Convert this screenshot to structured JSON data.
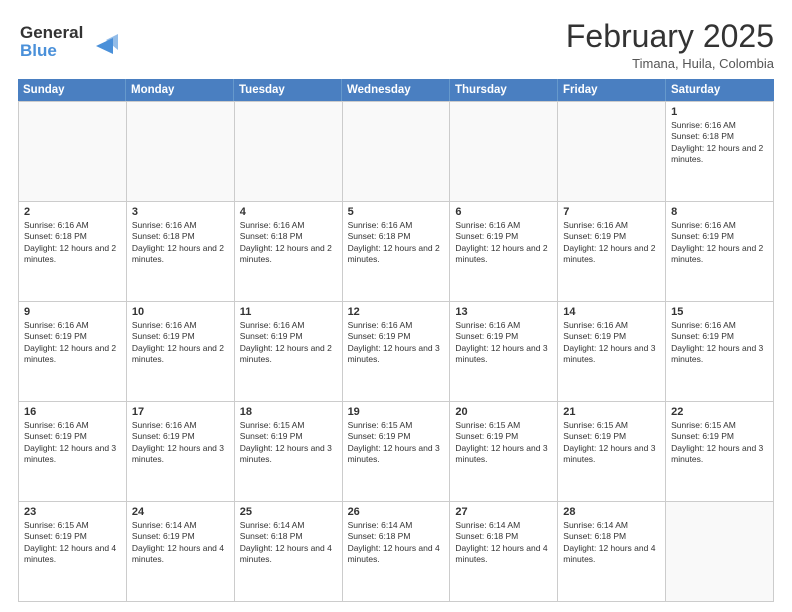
{
  "logo": {
    "line1": "General",
    "line2": "Blue",
    "arrow_color": "#4a90d9"
  },
  "title": {
    "month_year": "February 2025",
    "location": "Timana, Huila, Colombia"
  },
  "header_days": [
    "Sunday",
    "Monday",
    "Tuesday",
    "Wednesday",
    "Thursday",
    "Friday",
    "Saturday"
  ],
  "weeks": [
    {
      "days": [
        {
          "num": "",
          "info": ""
        },
        {
          "num": "",
          "info": ""
        },
        {
          "num": "",
          "info": ""
        },
        {
          "num": "",
          "info": ""
        },
        {
          "num": "",
          "info": ""
        },
        {
          "num": "",
          "info": ""
        },
        {
          "num": "1",
          "info": "Sunrise: 6:16 AM\nSunset: 6:18 PM\nDaylight: 12 hours and 2 minutes."
        }
      ]
    },
    {
      "days": [
        {
          "num": "2",
          "info": "Sunrise: 6:16 AM\nSunset: 6:18 PM\nDaylight: 12 hours and 2 minutes."
        },
        {
          "num": "3",
          "info": "Sunrise: 6:16 AM\nSunset: 6:18 PM\nDaylight: 12 hours and 2 minutes."
        },
        {
          "num": "4",
          "info": "Sunrise: 6:16 AM\nSunset: 6:18 PM\nDaylight: 12 hours and 2 minutes."
        },
        {
          "num": "5",
          "info": "Sunrise: 6:16 AM\nSunset: 6:18 PM\nDaylight: 12 hours and 2 minutes."
        },
        {
          "num": "6",
          "info": "Sunrise: 6:16 AM\nSunset: 6:19 PM\nDaylight: 12 hours and 2 minutes."
        },
        {
          "num": "7",
          "info": "Sunrise: 6:16 AM\nSunset: 6:19 PM\nDaylight: 12 hours and 2 minutes."
        },
        {
          "num": "8",
          "info": "Sunrise: 6:16 AM\nSunset: 6:19 PM\nDaylight: 12 hours and 2 minutes."
        }
      ]
    },
    {
      "days": [
        {
          "num": "9",
          "info": "Sunrise: 6:16 AM\nSunset: 6:19 PM\nDaylight: 12 hours and 2 minutes."
        },
        {
          "num": "10",
          "info": "Sunrise: 6:16 AM\nSunset: 6:19 PM\nDaylight: 12 hours and 2 minutes."
        },
        {
          "num": "11",
          "info": "Sunrise: 6:16 AM\nSunset: 6:19 PM\nDaylight: 12 hours and 2 minutes."
        },
        {
          "num": "12",
          "info": "Sunrise: 6:16 AM\nSunset: 6:19 PM\nDaylight: 12 hours and 3 minutes."
        },
        {
          "num": "13",
          "info": "Sunrise: 6:16 AM\nSunset: 6:19 PM\nDaylight: 12 hours and 3 minutes."
        },
        {
          "num": "14",
          "info": "Sunrise: 6:16 AM\nSunset: 6:19 PM\nDaylight: 12 hours and 3 minutes."
        },
        {
          "num": "15",
          "info": "Sunrise: 6:16 AM\nSunset: 6:19 PM\nDaylight: 12 hours and 3 minutes."
        }
      ]
    },
    {
      "days": [
        {
          "num": "16",
          "info": "Sunrise: 6:16 AM\nSunset: 6:19 PM\nDaylight: 12 hours and 3 minutes."
        },
        {
          "num": "17",
          "info": "Sunrise: 6:16 AM\nSunset: 6:19 PM\nDaylight: 12 hours and 3 minutes."
        },
        {
          "num": "18",
          "info": "Sunrise: 6:15 AM\nSunset: 6:19 PM\nDaylight: 12 hours and 3 minutes."
        },
        {
          "num": "19",
          "info": "Sunrise: 6:15 AM\nSunset: 6:19 PM\nDaylight: 12 hours and 3 minutes."
        },
        {
          "num": "20",
          "info": "Sunrise: 6:15 AM\nSunset: 6:19 PM\nDaylight: 12 hours and 3 minutes."
        },
        {
          "num": "21",
          "info": "Sunrise: 6:15 AM\nSunset: 6:19 PM\nDaylight: 12 hours and 3 minutes."
        },
        {
          "num": "22",
          "info": "Sunrise: 6:15 AM\nSunset: 6:19 PM\nDaylight: 12 hours and 3 minutes."
        }
      ]
    },
    {
      "days": [
        {
          "num": "23",
          "info": "Sunrise: 6:15 AM\nSunset: 6:19 PM\nDaylight: 12 hours and 4 minutes."
        },
        {
          "num": "24",
          "info": "Sunrise: 6:14 AM\nSunset: 6:19 PM\nDaylight: 12 hours and 4 minutes."
        },
        {
          "num": "25",
          "info": "Sunrise: 6:14 AM\nSunset: 6:18 PM\nDaylight: 12 hours and 4 minutes."
        },
        {
          "num": "26",
          "info": "Sunrise: 6:14 AM\nSunset: 6:18 PM\nDaylight: 12 hours and 4 minutes."
        },
        {
          "num": "27",
          "info": "Sunrise: 6:14 AM\nSunset: 6:18 PM\nDaylight: 12 hours and 4 minutes."
        },
        {
          "num": "28",
          "info": "Sunrise: 6:14 AM\nSunset: 6:18 PM\nDaylight: 12 hours and 4 minutes."
        },
        {
          "num": "",
          "info": ""
        }
      ]
    }
  ]
}
